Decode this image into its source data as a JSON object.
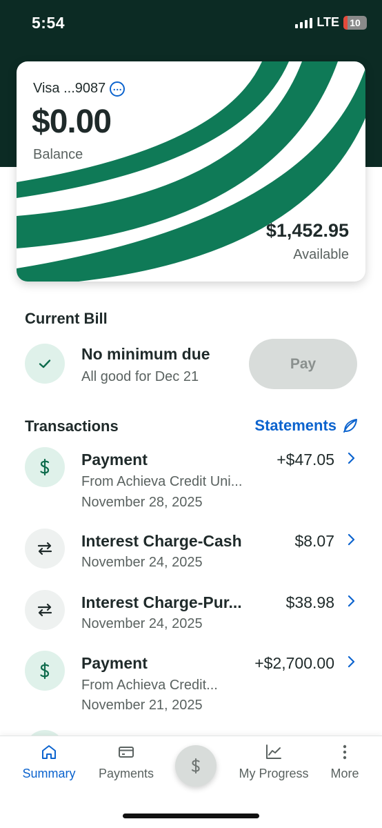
{
  "status_bar": {
    "time": "5:54",
    "network": "LTE",
    "battery": "10"
  },
  "card": {
    "name": "Visa ...9087",
    "more_icon": "ellipsis-circle-icon",
    "balance": "$0.00",
    "balance_label": "Balance",
    "available": "$1,452.95",
    "available_label": "Available",
    "accent_color": "#0f7a57"
  },
  "current_bill": {
    "title": "Current Bill",
    "status_icon": "check-icon",
    "status": "No minimum due",
    "detail": "All good for Dec 21",
    "pay_label": "Pay"
  },
  "transactions": {
    "title": "Transactions",
    "statements_label": "Statements",
    "statements_icon": "leaf-icon",
    "items": [
      {
        "icon": "dollar-icon",
        "title": "Payment",
        "subtitle": "From Achieva Credit Uni...",
        "date": "November 28, 2025",
        "amount": "+$47.05"
      },
      {
        "icon": "transfer-icon",
        "title": "Interest Charge-Cash",
        "date": "November 24, 2025",
        "amount": "$8.07"
      },
      {
        "icon": "transfer-icon",
        "title": "Interest Charge-Pur...",
        "date": "November 24, 2025",
        "amount": "$38.98"
      },
      {
        "icon": "dollar-icon",
        "title": "Payment",
        "subtitle": "From Achieva Credit...",
        "date": "November 21, 2025",
        "amount": "+$2,700.00"
      }
    ]
  },
  "tab_bar": {
    "tabs": [
      {
        "label": "Summary",
        "icon": "home-icon",
        "active": true
      },
      {
        "label": "Payments",
        "icon": "credit-card-icon",
        "active": false
      },
      {
        "label": "My Progress",
        "icon": "chart-line-icon",
        "active": false
      },
      {
        "label": "More",
        "icon": "vertical-dots-icon",
        "active": false
      }
    ],
    "center_icon": "dollar-icon"
  },
  "colors": {
    "header_bg": "#0c2b24",
    "link_blue": "#0b63ce",
    "brand_green": "#0f7a57"
  }
}
